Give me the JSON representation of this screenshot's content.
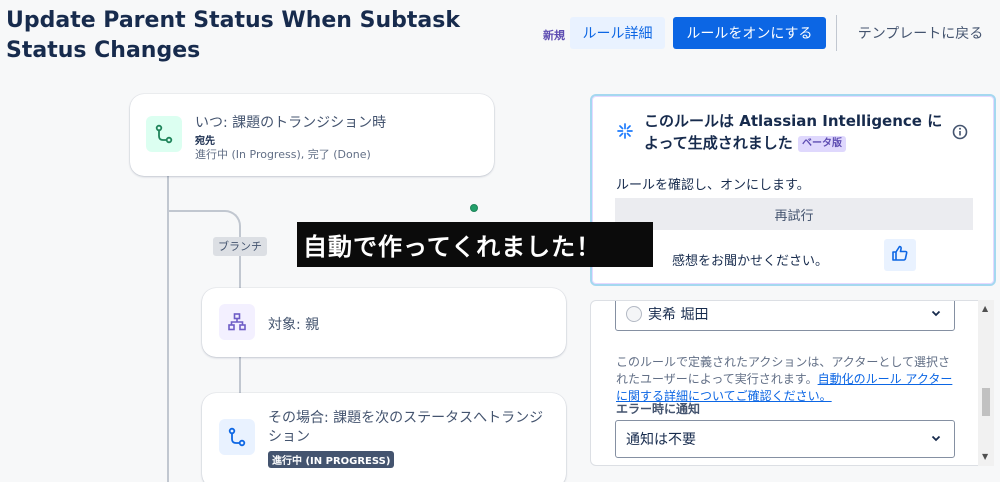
{
  "header": {
    "title": "Update Parent Status When Subtask Status Changes",
    "new_badge": "新規",
    "rule_details_label": "ルール詳細",
    "turn_on_label": "ルールをオンにする",
    "back_to_templates_label": "テンプレートに戻る"
  },
  "flow": {
    "trigger": {
      "title": "いつ: 課題のトランジション時",
      "label": "宛先",
      "statuses": "進行中 (In Progress), 完了 (Done)",
      "icon": "transition-icon"
    },
    "branch_label": "ブランチ",
    "branch": {
      "title": "対象: 親",
      "icon": "hierarchy-icon"
    },
    "action": {
      "title": "その場合: 課題を次のステータスへトランジション",
      "status": "進行中 (IN PROGRESS)",
      "icon": "transition-icon"
    }
  },
  "ai_panel": {
    "title": "このルールは Atlassian Intelligence によって生成されました",
    "beta": "ベータ版",
    "description": "ルールを確認し、オンにします。",
    "retry_label": "再試行",
    "feedback_label": "感想をお聞かせください。"
  },
  "settings": {
    "actor_name": "実希 堀田",
    "help_text": "このルールで定義されたアクションは、アクターとして選択されたユーザーによって実行されます。",
    "help_link": "自動化のルール アクターに関する詳細についてご確認ください。",
    "error_notify_label": "エラー時に通知",
    "error_notify_value": "通知は不要"
  },
  "caption": "自動で作ってくれました！",
  "colors": {
    "primary": "#0c66e4",
    "trigger_icon_bg": "#dcfff1",
    "branch_icon_bg": "#f3f0ff",
    "action_icon_bg": "#e9f2ff"
  }
}
